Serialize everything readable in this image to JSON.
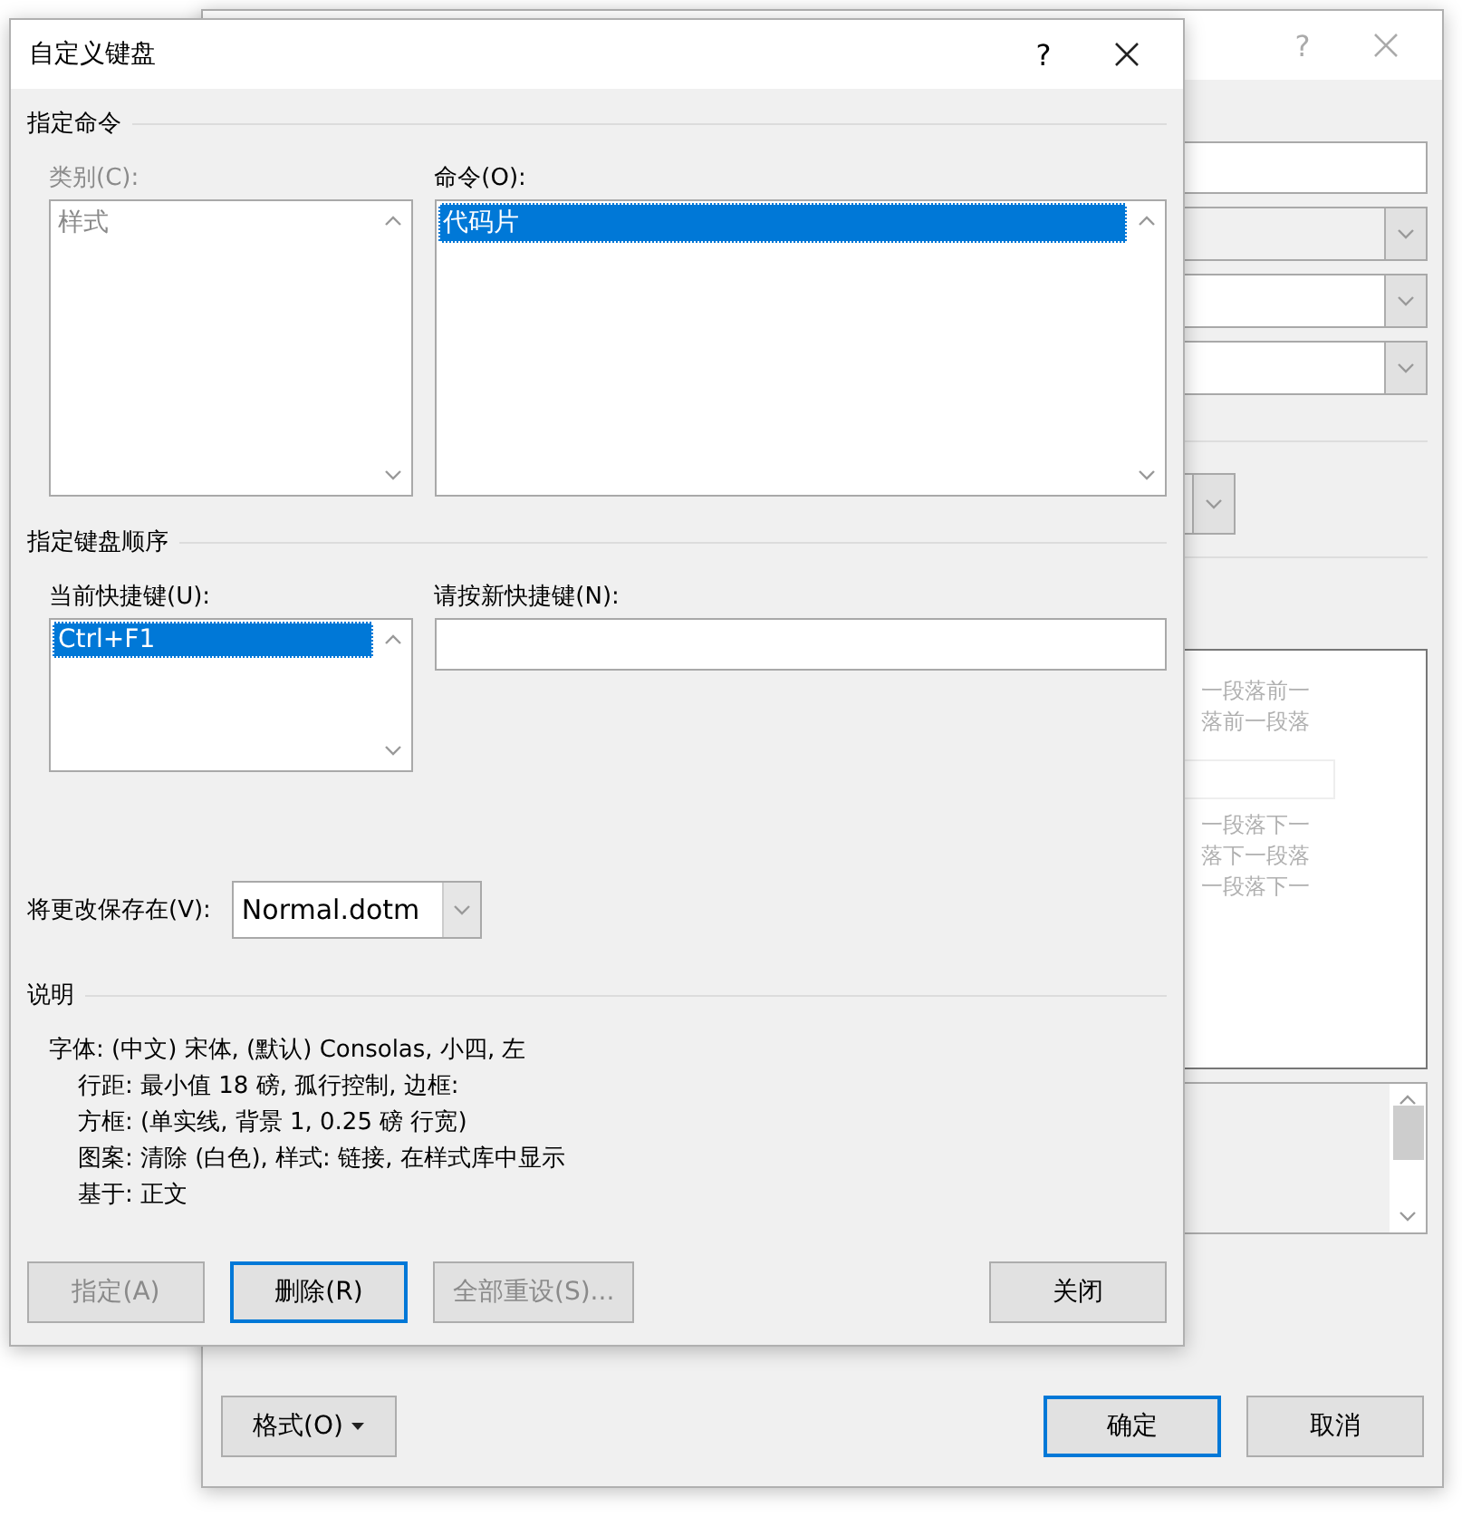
{
  "background_dialog": {
    "help_button": "?",
    "preview_before": [
      "一段落前一",
      "落前一段落"
    ],
    "preview_after": [
      "一段落下一",
      "落下一段落",
      "一段落下一"
    ],
    "format_button": "格式(O)",
    "buttons": [
      {
        "label": "确定",
        "focused": true
      },
      {
        "label": "取消",
        "focused": false
      }
    ]
  },
  "dialog": {
    "title": "自定义键盘",
    "help_button": "?",
    "specify_command": {
      "heading": "指定命令",
      "categories": {
        "label": "类别(C):",
        "disabled": true,
        "items": [
          {
            "text": "样式",
            "selected": false
          }
        ]
      },
      "commands": {
        "label": "命令(O):",
        "disabled": false,
        "items": [
          {
            "text": "代码片",
            "selected": true
          }
        ]
      }
    },
    "keyboard_sequence": {
      "heading": "指定键盘顺序",
      "current_keys": {
        "label": "当前快捷键(U):",
        "items": [
          {
            "text": "Ctrl+F1",
            "selected": true
          }
        ]
      },
      "new_key": {
        "label": "请按新快捷键(N):"
      }
    },
    "save_in": {
      "label": "将更改保存在(V):",
      "value": "Normal.dotm"
    },
    "description": {
      "heading": "说明",
      "first_line": "字体: (中文) 宋体, (默认) Consolas, 小四, 左",
      "continued_lines": [
        "行距: 最小值 18 磅, 孤行控制, 边框:",
        "方框: (单实线, 背景 1,  0.25 磅 行宽)",
        "图案: 清除 (白色), 样式: 链接, 在样式库中显示",
        "基于: 正文"
      ]
    },
    "buttons": [
      {
        "label": "指定(A)",
        "disabled": true,
        "focused": false
      },
      {
        "label": "删除(R)",
        "disabled": false,
        "focused": true
      },
      {
        "label": "全部重设(S)...",
        "disabled": true,
        "focused": false
      }
    ],
    "close_button": {
      "label": "关闭",
      "disabled": false,
      "focused": false
    }
  }
}
